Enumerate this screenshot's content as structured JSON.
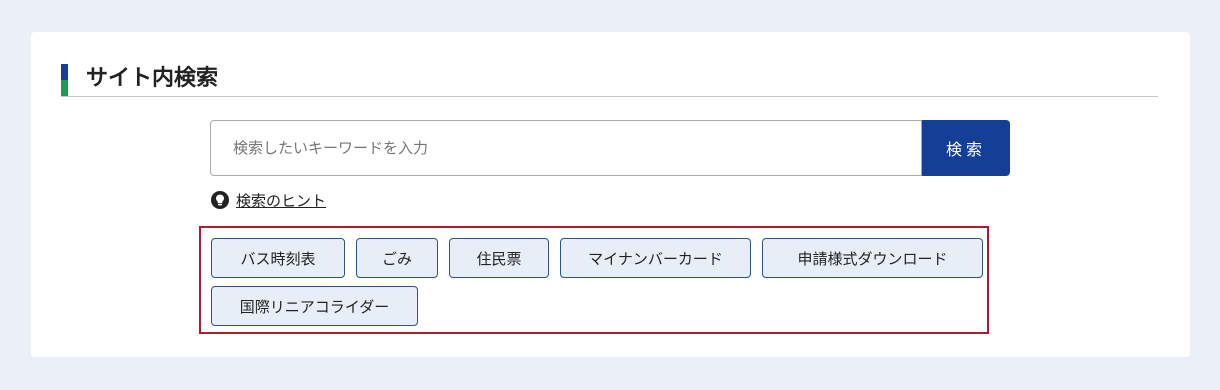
{
  "heading": {
    "title": "サイト内検索"
  },
  "search": {
    "placeholder": "検索したいキーワードを入力",
    "value": "",
    "button_label": "検索"
  },
  "hint": {
    "label": "検索のヒント",
    "icon": "lightbulb-icon"
  },
  "keywords": [
    "バス時刻表",
    "ごみ",
    "住民票",
    "マイナンバーカード",
    "申請様式ダウンロード",
    "国際リニアコライダー"
  ],
  "colors": {
    "page_background": "#ebf0f8",
    "primary_blue": "#143f96",
    "accent_green": "#1e9a52",
    "highlight_red": "#a91f2b",
    "keyword_background": "#e8eef8"
  }
}
